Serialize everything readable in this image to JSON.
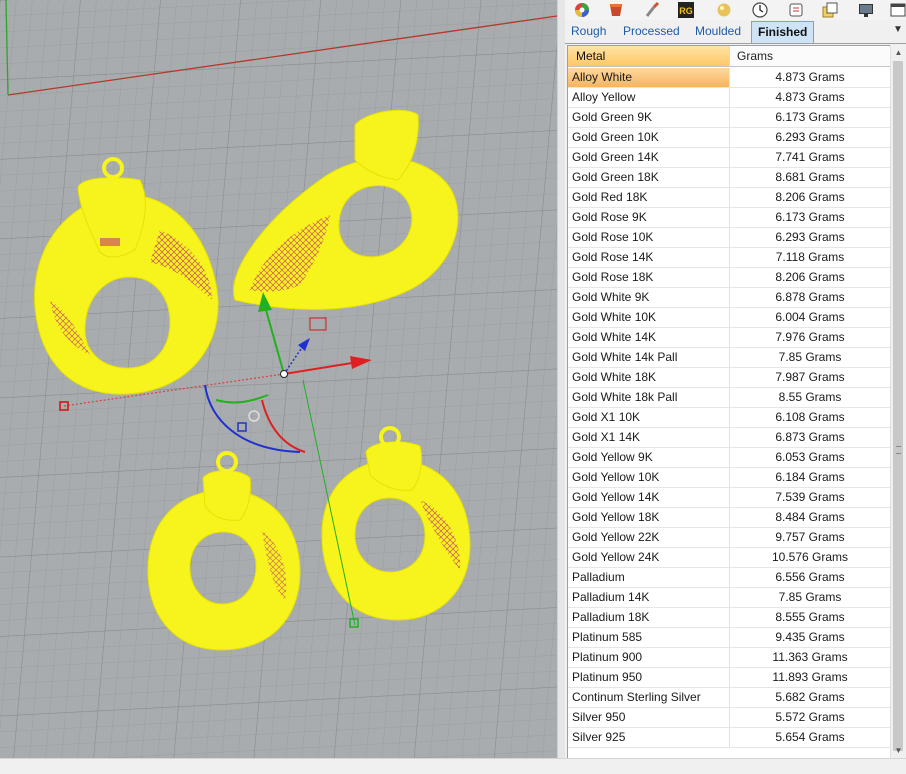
{
  "toolbar": {
    "icons": [
      "color-wheel-icon",
      "material-icon",
      "brush-icon",
      "rg-icon",
      "gold-sphere-icon",
      "clock-icon",
      "printer-icon",
      "layer-icon",
      "monitor-icon",
      "window-icon"
    ]
  },
  "tabs": [
    {
      "label": "Rough",
      "active": false
    },
    {
      "label": "Processed",
      "active": false
    },
    {
      "label": "Moulded",
      "active": false
    },
    {
      "label": "Finished",
      "active": true
    }
  ],
  "table": {
    "columns": [
      "Metal",
      "Grams"
    ],
    "rows": [
      {
        "metal": "Alloy White",
        "grams": "4.873 Grams",
        "selected": true
      },
      {
        "metal": "Alloy Yellow",
        "grams": "4.873 Grams"
      },
      {
        "metal": "Gold Green 9K",
        "grams": "6.173 Grams"
      },
      {
        "metal": "Gold Green 10K",
        "grams": "6.293 Grams"
      },
      {
        "metal": "Gold Green 14K",
        "grams": "7.741 Grams"
      },
      {
        "metal": "Gold Green 18K",
        "grams": "8.681 Grams"
      },
      {
        "metal": "Gold Red 18K",
        "grams": "8.206 Grams"
      },
      {
        "metal": "Gold Rose 9K",
        "grams": "6.173 Grams"
      },
      {
        "metal": "Gold Rose 10K",
        "grams": "6.293 Grams"
      },
      {
        "metal": "Gold Rose 14K",
        "grams": "7.118 Grams"
      },
      {
        "metal": "Gold Rose 18K",
        "grams": "8.206 Grams"
      },
      {
        "metal": "Gold White 9K",
        "grams": "6.878 Grams"
      },
      {
        "metal": "Gold White 10K",
        "grams": "6.004 Grams"
      },
      {
        "metal": "Gold White 14K",
        "grams": "7.976 Grams"
      },
      {
        "metal": "Gold White 14k Pall",
        "grams": "7.85 Grams"
      },
      {
        "metal": "Gold White 18K",
        "grams": "7.987 Grams"
      },
      {
        "metal": "Gold White 18k Pall",
        "grams": "8.55 Grams"
      },
      {
        "metal": "Gold X1 10K",
        "grams": "6.108 Grams"
      },
      {
        "metal": "Gold X1 14K",
        "grams": "6.873 Grams"
      },
      {
        "metal": "Gold Yellow 9K",
        "grams": "6.053 Grams"
      },
      {
        "metal": "Gold Yellow 10K",
        "grams": "6.184 Grams"
      },
      {
        "metal": "Gold Yellow 14K",
        "grams": "7.539 Grams"
      },
      {
        "metal": "Gold Yellow 18K",
        "grams": "8.484 Grams"
      },
      {
        "metal": "Gold Yellow 22K",
        "grams": "9.757 Grams"
      },
      {
        "metal": "Gold Yellow 24K",
        "grams": "10.576 Grams"
      },
      {
        "metal": "Palladium",
        "grams": "6.556 Grams"
      },
      {
        "metal": "Palladium 14K",
        "grams": "7.85 Grams"
      },
      {
        "metal": "Palladium 18K",
        "grams": "8.555 Grams"
      },
      {
        "metal": "Platinum 585",
        "grams": "9.435 Grams"
      },
      {
        "metal": "Platinum 900",
        "grams": "11.363 Grams"
      },
      {
        "metal": "Platinum 950",
        "grams": "11.893 Grams"
      },
      {
        "metal": "Continum Sterling Silver",
        "grams": "5.682 Grams"
      },
      {
        "metal": "Silver 950",
        "grams": "5.572 Grams"
      },
      {
        "metal": "Silver 925",
        "grams": "5.654 Grams"
      }
    ]
  },
  "colors": {
    "model_wire": "#f7f31d",
    "grid_bg": "#a9acae",
    "grid_line": "#8f9396",
    "x_axis": "#b23a2a",
    "y_axis": "#2aa62a",
    "gumball_x": "#e02020",
    "gumball_y": "#20b020",
    "gumball_z": "#2030d0",
    "header_accent": "#ffc867"
  }
}
